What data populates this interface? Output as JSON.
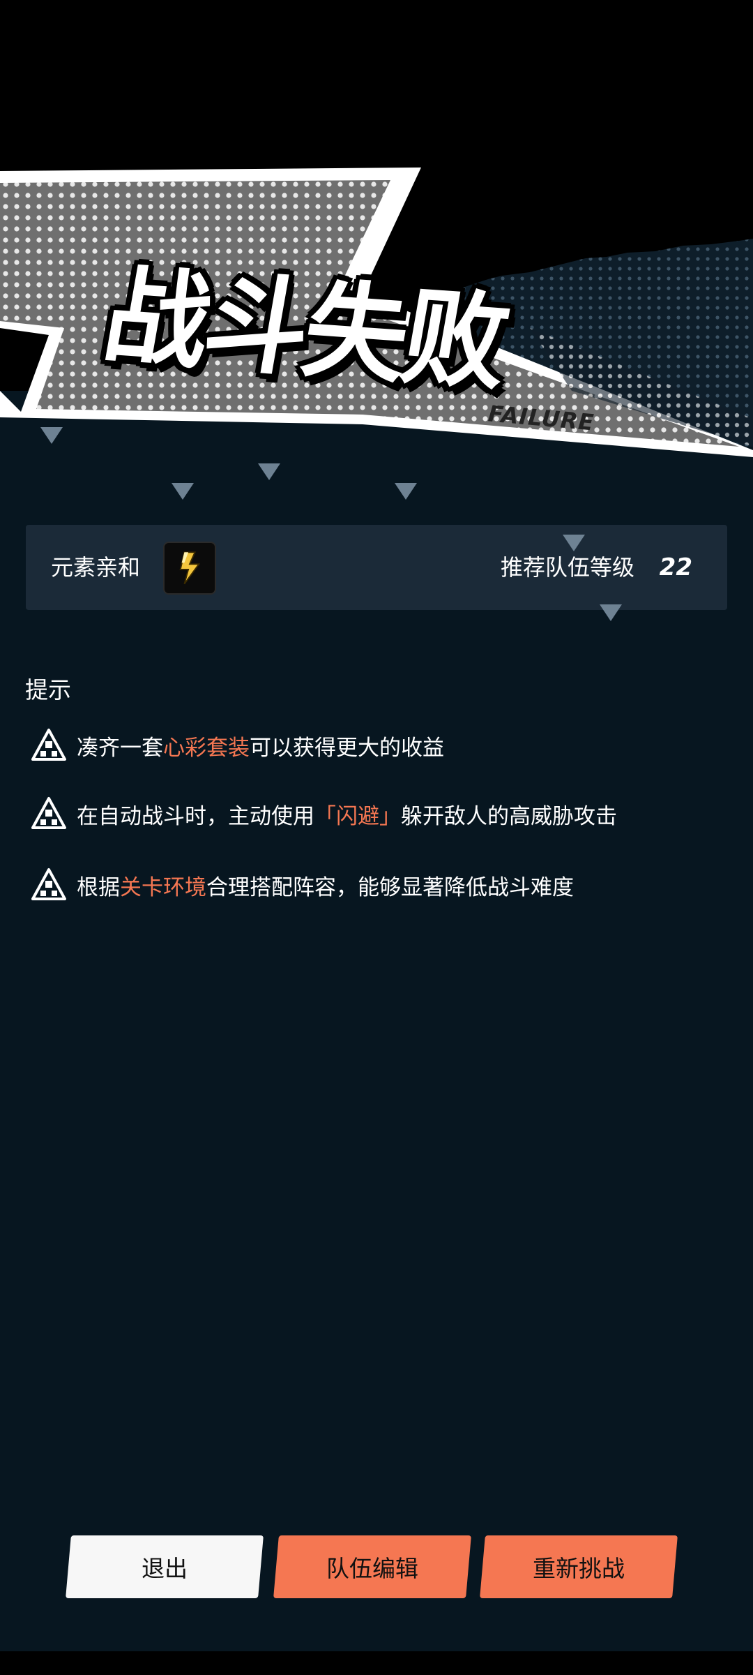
{
  "title": {
    "main": "战斗失败",
    "sub": "FAILURE"
  },
  "info": {
    "element_label": "元素亲和",
    "element_icon": "lightning-icon",
    "level_label": "推荐队伍等级",
    "level_value": "22"
  },
  "tips": {
    "heading": "提示",
    "icon": "warning-triangle-icon",
    "items": [
      {
        "pre": "凑齐一套",
        "hl": "心彩套装",
        "post": "可以获得更大的收益"
      },
      {
        "pre": "在自动战斗时，主动使用",
        "hl": "「闪避」",
        "post": "躲开敌人的高威胁攻击"
      },
      {
        "pre": "根据",
        "hl": "关卡环境",
        "post": "合理搭配阵容，能够显著降低战斗难度"
      }
    ]
  },
  "buttons": {
    "exit": "退出",
    "team_edit": "队伍编辑",
    "retry": "重新挑战"
  },
  "colors": {
    "accent": "#f57752",
    "background": "#071620",
    "panel": "#1b2a38",
    "button_light": "#f7f7f7"
  }
}
